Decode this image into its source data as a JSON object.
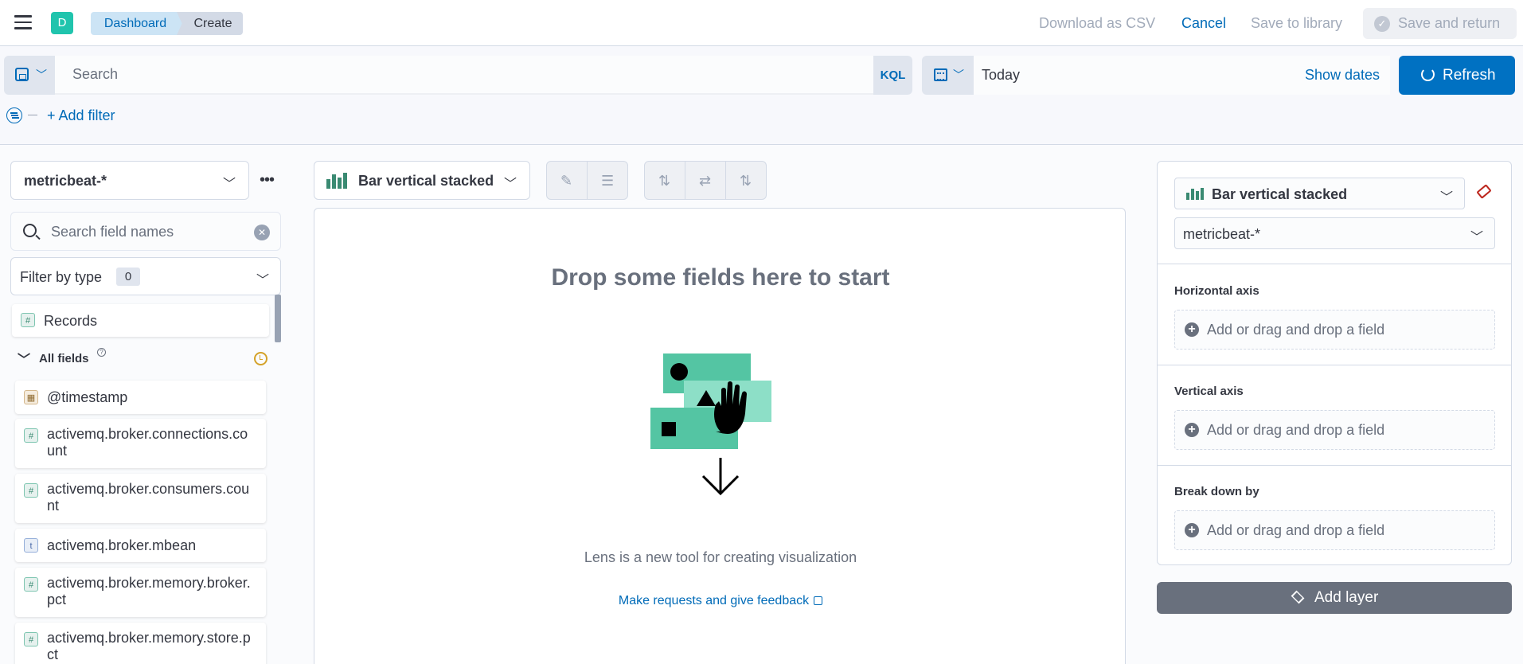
{
  "header": {
    "space_initial": "D",
    "breadcrumbs": [
      "Dashboard",
      "Create"
    ],
    "download_csv": "Download as CSV",
    "cancel": "Cancel",
    "save_to_library": "Save to library",
    "save_and_return": "Save and return"
  },
  "query_bar": {
    "search_placeholder": "Search",
    "language": "KQL",
    "date_value": "Today",
    "show_dates": "Show dates",
    "refresh": "Refresh",
    "add_filter": "+ Add filter"
  },
  "sidebar": {
    "index_pattern": "metricbeat-*",
    "field_search_placeholder": "Search field names",
    "filter_by_type": "Filter by type",
    "filter_count": "0",
    "records": {
      "type": "#",
      "label": "Records"
    },
    "all_fields_label": "All fields",
    "fields": [
      {
        "type": "date",
        "icon": "▦",
        "name": "@timestamp"
      },
      {
        "type": "number",
        "icon": "#",
        "name": "activemq.broker.connections.count"
      },
      {
        "type": "number",
        "icon": "#",
        "name": "activemq.broker.consumers.count"
      },
      {
        "type": "string",
        "icon": "t",
        "name": "activemq.broker.mbean"
      },
      {
        "type": "number",
        "icon": "#",
        "name": "activemq.broker.memory.broker.pct"
      },
      {
        "type": "number",
        "icon": "#",
        "name": "activemq.broker.memory.store.pct"
      }
    ]
  },
  "workspace": {
    "chart_type": "Bar vertical stacked",
    "drop_title": "Drop some fields here to start",
    "description": "Lens is a new tool for creating visualization",
    "feedback_link": "Make requests and give feedback"
  },
  "config": {
    "chart_type": "Bar vertical stacked",
    "index_pattern": "metricbeat-*",
    "horizontal_axis": "Horizontal axis",
    "vertical_axis": "Vertical axis",
    "break_down_by": "Break down by",
    "drop_hint": "Add or drag and drop a field",
    "add_layer": "Add layer"
  },
  "colors": {
    "primary": "#0071c2",
    "link": "#006bb8",
    "accent_teal": "#20c4ad",
    "illustration_green": "#54c5a3"
  }
}
